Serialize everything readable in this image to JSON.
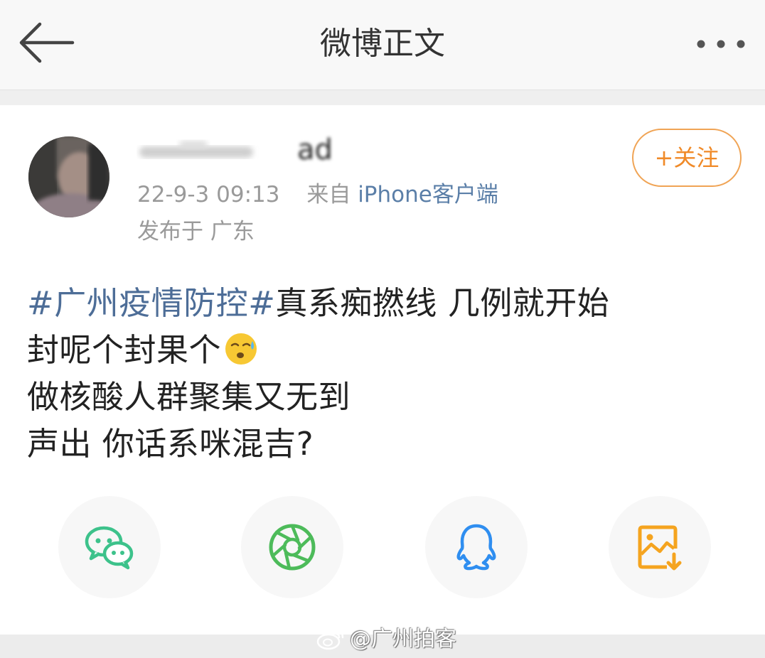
{
  "header": {
    "title": "微博正文",
    "back_icon": "back-arrow-icon",
    "more_icon": "more-dots-icon"
  },
  "post": {
    "username_visible_fragment": "ad",
    "date": "22-9-3 09:13",
    "source_prefix": "来自",
    "source": "iPhone客户端",
    "location": "发布于 广东",
    "follow_label": "+关注",
    "topic": "#广州疫情防控#",
    "lines": [
      "真系痴撚线 几例就开始",
      "封呢个封果个",
      "做核酸人群聚集又无到",
      "声出 你话系咪混吉?"
    ],
    "emoji": "sweat-emoji"
  },
  "share": {
    "items": [
      {
        "icon": "wechat-icon",
        "color": "#3dc28b"
      },
      {
        "icon": "moments-icon",
        "color": "#4dbb5a"
      },
      {
        "icon": "qq-icon",
        "color": "#2f8ef0"
      },
      {
        "icon": "save-image-icon",
        "color": "#f5a41f"
      }
    ]
  },
  "watermark": "@广州拍客",
  "colors": {
    "link": "#4d6d97",
    "follow": "#f08a28",
    "meta": "#9a9a9a"
  }
}
